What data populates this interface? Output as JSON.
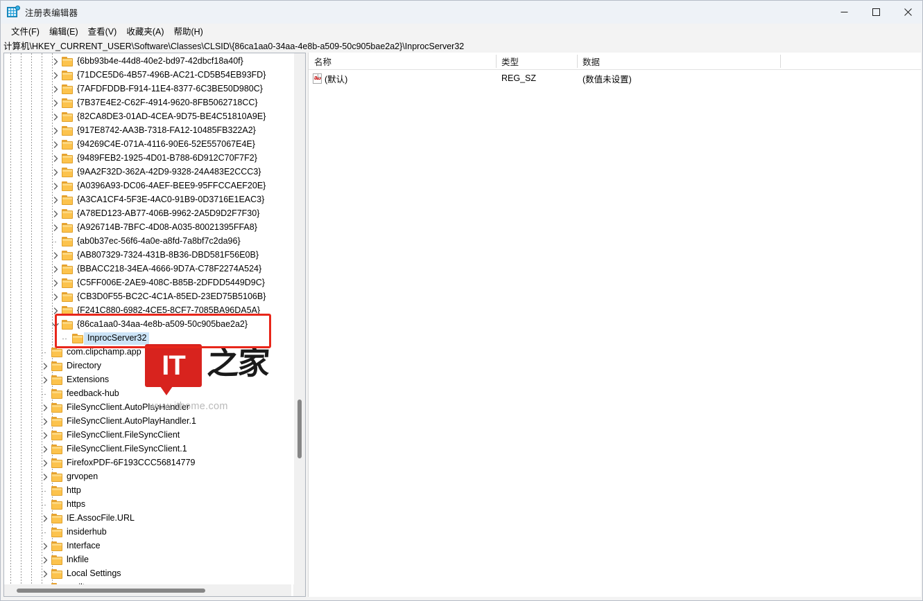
{
  "window": {
    "title": "注册表编辑器",
    "icon": "registry-editor-icon",
    "controls": {
      "minimize": "−",
      "maximize": "□",
      "close": "✕"
    }
  },
  "menu": {
    "items": [
      {
        "label": "文件(F)",
        "name": "menu-file"
      },
      {
        "label": "编辑(E)",
        "name": "menu-edit"
      },
      {
        "label": "查看(V)",
        "name": "menu-view"
      },
      {
        "label": "收藏夹(A)",
        "name": "menu-favorites"
      },
      {
        "label": "帮助(H)",
        "name": "menu-help"
      }
    ]
  },
  "address": {
    "path": "计算机\\HKEY_CURRENT_USER\\Software\\Classes\\CLSID\\{86ca1aa0-34aa-4e8b-a509-50c905bae2a2}\\InprocServer32"
  },
  "tree": {
    "items": [
      {
        "label": "{6bb93b4e-44d8-40e2-bd97-42dbcf18a40f}",
        "indent": 5,
        "expander": "collapsed",
        "selected": false
      },
      {
        "label": "{71DCE5D6-4B57-496B-AC21-CD5B54EB93FD}",
        "indent": 5,
        "expander": "collapsed",
        "selected": false
      },
      {
        "label": "{7AFDFDDB-F914-11E4-8377-6C3BE50D980C}",
        "indent": 5,
        "expander": "collapsed",
        "selected": false
      },
      {
        "label": "{7B37E4E2-C62F-4914-9620-8FB5062718CC}",
        "indent": 5,
        "expander": "collapsed",
        "selected": false
      },
      {
        "label": "{82CA8DE3-01AD-4CEA-9D75-BE4C51810A9E}",
        "indent": 5,
        "expander": "collapsed",
        "selected": false
      },
      {
        "label": "{917E8742-AA3B-7318-FA12-10485FB322A2}",
        "indent": 5,
        "expander": "collapsed",
        "selected": false
      },
      {
        "label": "{94269C4E-071A-4116-90E6-52E557067E4E}",
        "indent": 5,
        "expander": "collapsed",
        "selected": false
      },
      {
        "label": "{9489FEB2-1925-4D01-B788-6D912C70F7F2}",
        "indent": 5,
        "expander": "collapsed",
        "selected": false
      },
      {
        "label": "{9AA2F32D-362A-42D9-9328-24A483E2CCC3}",
        "indent": 5,
        "expander": "collapsed",
        "selected": false
      },
      {
        "label": "{A0396A93-DC06-4AEF-BEE9-95FFCCAEF20E}",
        "indent": 5,
        "expander": "collapsed",
        "selected": false
      },
      {
        "label": "{A3CA1CF4-5F3E-4AC0-91B9-0D3716E1EAC3}",
        "indent": 5,
        "expander": "collapsed",
        "selected": false
      },
      {
        "label": "{A78ED123-AB77-406B-9962-2A5D9D2F7F30}",
        "indent": 5,
        "expander": "collapsed",
        "selected": false
      },
      {
        "label": "{A926714B-7BFC-4D08-A035-80021395FFA8}",
        "indent": 5,
        "expander": "collapsed",
        "selected": false
      },
      {
        "label": "{ab0b37ec-56f6-4a0e-a8fd-7a8bf7c2da96}",
        "indent": 5,
        "expander": "none",
        "selected": false
      },
      {
        "label": "{AB807329-7324-431B-8B36-DBD581F56E0B}",
        "indent": 5,
        "expander": "collapsed",
        "selected": false
      },
      {
        "label": "{BBACC218-34EA-4666-9D7A-C78F2274A524}",
        "indent": 5,
        "expander": "collapsed",
        "selected": false
      },
      {
        "label": "{C5FF006E-2AE9-408C-B85B-2DFDD5449D9C}",
        "indent": 5,
        "expander": "collapsed",
        "selected": false
      },
      {
        "label": "{CB3D0F55-BC2C-4C1A-85ED-23ED75B5106B}",
        "indent": 5,
        "expander": "collapsed",
        "selected": false
      },
      {
        "label": "{F241C880-6982-4CE5-8CF7-7085BA96DA5A}",
        "indent": 5,
        "expander": "collapsed",
        "selected": false
      },
      {
        "label": "{86ca1aa0-34aa-4e8b-a509-50c905bae2a2}",
        "indent": 5,
        "expander": "expanded",
        "selected": false
      },
      {
        "label": "InprocServer32",
        "indent": 6,
        "expander": "none",
        "selected": true
      },
      {
        "label": "com.clipchamp.app",
        "indent": 4,
        "expander": "none",
        "selected": false
      },
      {
        "label": "Directory",
        "indent": 4,
        "expander": "collapsed",
        "selected": false
      },
      {
        "label": "Extensions",
        "indent": 4,
        "expander": "collapsed",
        "selected": false
      },
      {
        "label": "feedback-hub",
        "indent": 4,
        "expander": "none",
        "selected": false
      },
      {
        "label": "FileSyncClient.AutoPlayHandler",
        "indent": 4,
        "expander": "collapsed",
        "selected": false
      },
      {
        "label": "FileSyncClient.AutoPlayHandler.1",
        "indent": 4,
        "expander": "collapsed",
        "selected": false
      },
      {
        "label": "FileSyncClient.FileSyncClient",
        "indent": 4,
        "expander": "collapsed",
        "selected": false
      },
      {
        "label": "FileSyncClient.FileSyncClient.1",
        "indent": 4,
        "expander": "collapsed",
        "selected": false
      },
      {
        "label": "FirefoxPDF-6F193CCC56814779",
        "indent": 4,
        "expander": "collapsed",
        "selected": false
      },
      {
        "label": "grvopen",
        "indent": 4,
        "expander": "collapsed",
        "selected": false
      },
      {
        "label": "http",
        "indent": 4,
        "expander": "none",
        "selected": false
      },
      {
        "label": "https",
        "indent": 4,
        "expander": "none",
        "selected": false
      },
      {
        "label": "IE.AssocFile.URL",
        "indent": 4,
        "expander": "collapsed",
        "selected": false
      },
      {
        "label": "insiderhub",
        "indent": 4,
        "expander": "none",
        "selected": false
      },
      {
        "label": "Interface",
        "indent": 4,
        "expander": "collapsed",
        "selected": false
      },
      {
        "label": "lnkfile",
        "indent": 4,
        "expander": "collapsed",
        "selected": false
      },
      {
        "label": "Local Settings",
        "indent": 4,
        "expander": "collapsed",
        "selected": false
      },
      {
        "label": "mailto",
        "indent": 4,
        "expander": "none",
        "selected": false
      }
    ]
  },
  "values": {
    "columns": [
      {
        "label": "名称",
        "name": "column-name"
      },
      {
        "label": "类型",
        "name": "column-type"
      },
      {
        "label": "数据",
        "name": "column-data"
      }
    ],
    "rows": [
      {
        "name": "(默认)",
        "type": "REG_SZ",
        "data": "(数值未设置)",
        "icon": "ab-string-icon"
      }
    ]
  },
  "watermark": {
    "logo_text": "IT",
    "logo_cn": "之家",
    "url": "www.ithome.com"
  },
  "colors": {
    "accent_red": "#e8261a",
    "selection_blue": "#cce4f7",
    "folder_yellow": "#fcc34d",
    "watermark_red": "#d8231e"
  }
}
